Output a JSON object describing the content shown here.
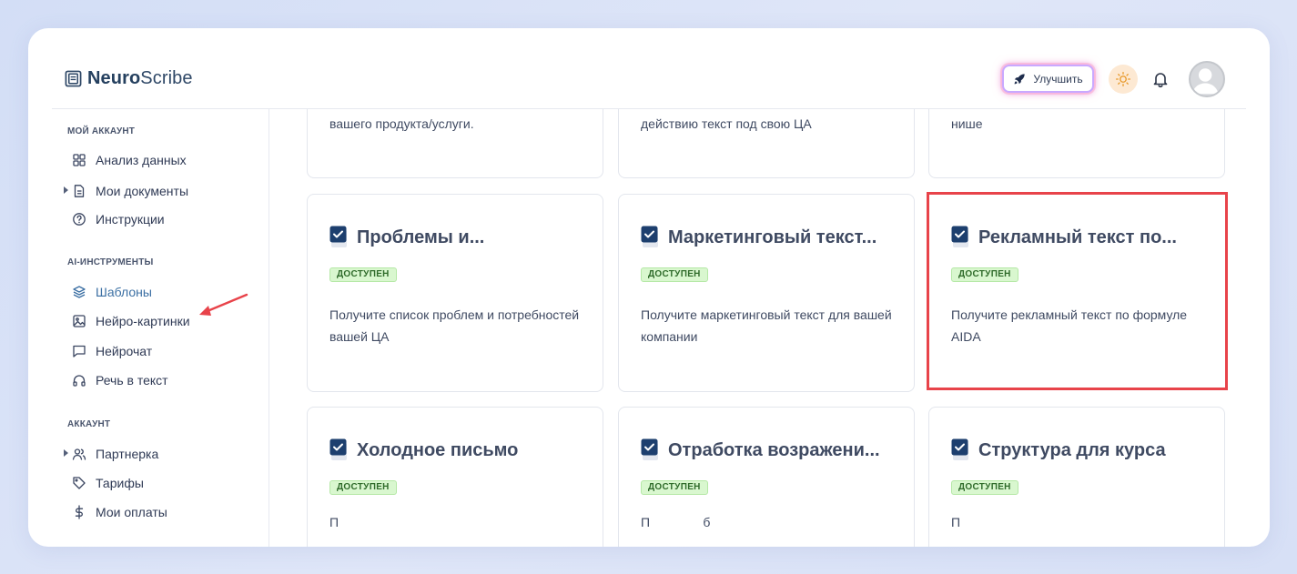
{
  "header": {
    "logo_bold": "Neuro",
    "logo_rest": "Scribe",
    "upgrade_label": "Улучшить"
  },
  "sidebar": {
    "sections": {
      "account_mine": "МОЙ АККАУНТ",
      "ai_tools": "AI-ИНСТРУМЕНТЫ",
      "account": "АККАУНТ"
    },
    "items": {
      "analytics": "Анализ данных",
      "documents": "Мои документы",
      "instructions": "Инструкции",
      "templates": "Шаблоны",
      "neuro_images": "Нейро-картинки",
      "neurochat": "Нейрочат",
      "speech_to_text": "Речь в текст",
      "partner": "Партнерка",
      "tariffs": "Тарифы",
      "payments": "Мои оплаты"
    }
  },
  "cards": {
    "top": [
      {
        "desc": "вашего продукта/услуги."
      },
      {
        "desc": "действию текст под свою ЦА"
      },
      {
        "desc": "нише"
      }
    ],
    "middle": [
      {
        "title": "Проблемы и...",
        "badge": "ДОСТУПЕН",
        "desc": "Получите список проблем и потребностей вашей ЦА"
      },
      {
        "title": "Маркетинговый текст...",
        "badge": "ДОСТУПЕН",
        "desc": "Получите маркетинговый текст для вашей компании"
      },
      {
        "title": "Рекламный текст по...",
        "badge": "ДОСТУПЕН",
        "desc": "Получите рекламный текст по формуле AIDA"
      }
    ],
    "bottom": [
      {
        "title": "Холодное письмо",
        "badge": "ДОСТУПЕН",
        "desc": "П"
      },
      {
        "title": "Отработка возражени...",
        "badge": "ДОСТУПЕН",
        "desc": "П               б"
      },
      {
        "title": "Структура для курса",
        "badge": "ДОСТУПЕН",
        "desc": "П"
      }
    ]
  },
  "colors": {
    "accent": "#3b6fa3",
    "highlight": "#e8434a",
    "badge_bg": "#d9f7cf",
    "arrow": "#e8434a"
  }
}
